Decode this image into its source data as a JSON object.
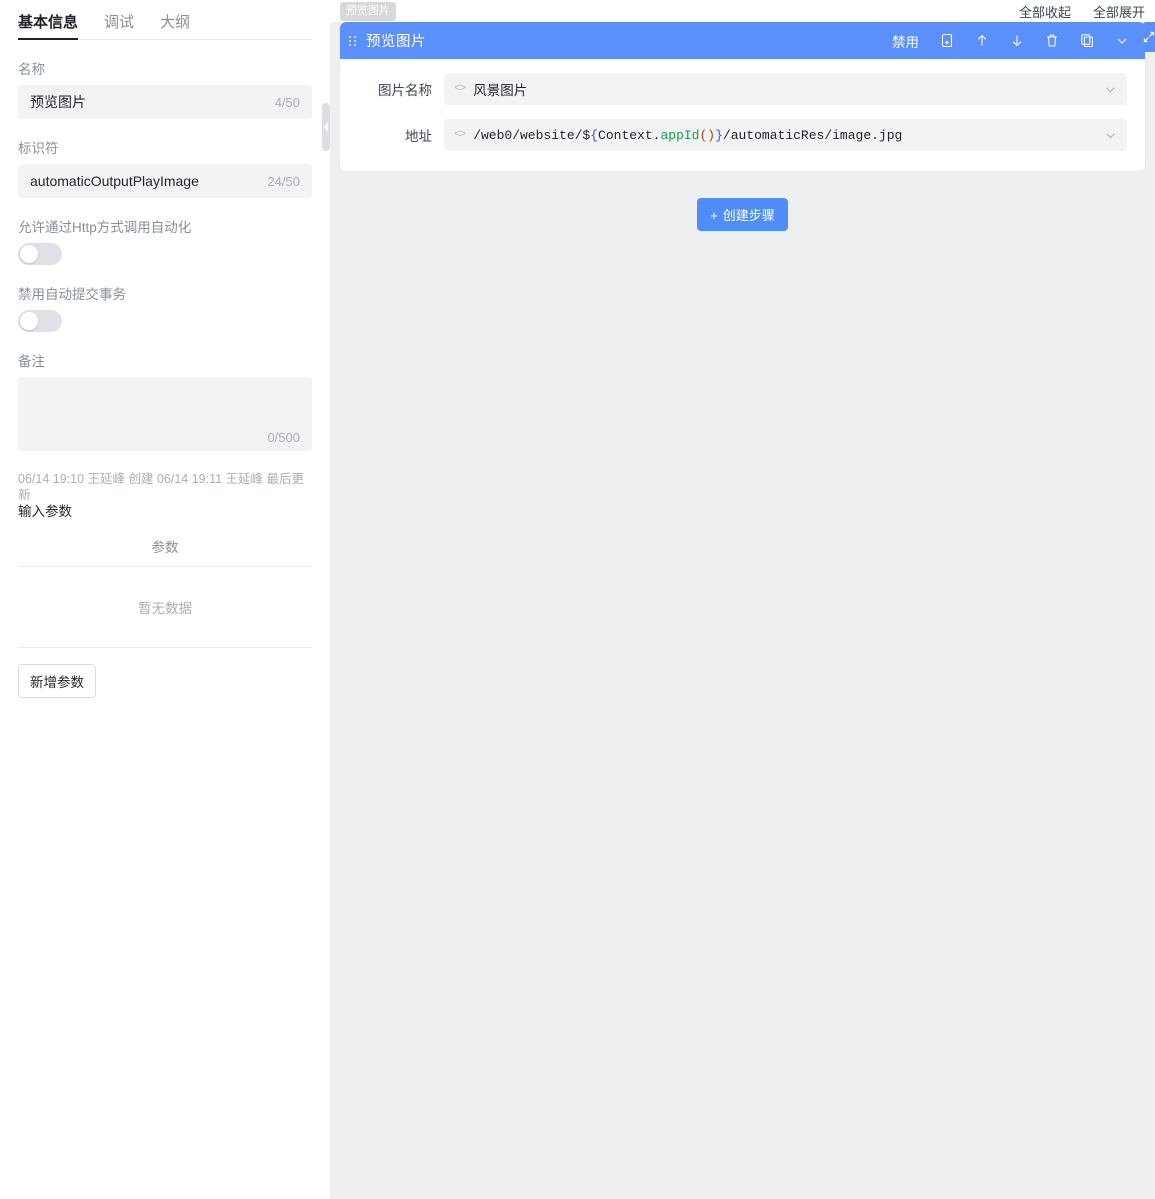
{
  "left_panel": {
    "tabs": [
      {
        "label": "基本信息",
        "active": true
      },
      {
        "label": "调试",
        "active": false
      },
      {
        "label": "大纲",
        "active": false
      }
    ],
    "fields": {
      "name_label": "名称",
      "name_value": "预览图片",
      "name_counter": "4/50",
      "identifier_label": "标识符",
      "identifier_value": "automaticOutputPlayImage",
      "identifier_counter": "24/50",
      "http_toggle_label": "允许通过Http方式调用自动化",
      "http_toggle_state": "off",
      "autocommit_toggle_label": "禁用自动提交事务",
      "autocommit_toggle_state": "off",
      "remark_label": "备注",
      "remark_value": "",
      "remark_counter": "0/500"
    },
    "meta_text": "06/14 19:10 王延峰 创建 06/14 19:11 王延峰 最后更新",
    "input_params": {
      "section_title": "输入参数",
      "column_header": "参数",
      "empty_text": "暂无数据",
      "add_button_label": "新增参数"
    },
    "collapse_handle_icon": "chevron-left-icon"
  },
  "right_panel": {
    "breadcrumb_tag": "预览图片",
    "toolbar": {
      "collapse_all_label": "全部收起",
      "expand_all_label": "全部展开"
    },
    "step_card": {
      "title": "预览图片",
      "drag_handle_icon": "drag-dots-icon",
      "header_actions": {
        "disable_label": "禁用",
        "icons": [
          "document-copy-icon",
          "arrow-up-icon",
          "arrow-down-icon",
          "trash-icon",
          "duplicate-icon",
          "chevron-down-icon"
        ]
      },
      "rows": [
        {
          "label": "图片名称",
          "prefix_icon": "code-brackets-icon",
          "value": "风景图片",
          "mono": false,
          "suffix_icon": "chevron-down-icon"
        },
        {
          "label": "地址",
          "prefix_icon": "code-brackets-icon",
          "value": "/web0/website/${Context.appId()}/automaticRes/image.jpg",
          "mono": true,
          "suffix_icon": "chevron-down-icon",
          "tokens": [
            {
              "t": "/web0/website/$",
              "c": "plain"
            },
            {
              "t": "{",
              "c": "brace"
            },
            {
              "t": "Context.",
              "c": "plain"
            },
            {
              "t": "appId",
              "c": "fn"
            },
            {
              "t": "()",
              "c": "paren"
            },
            {
              "t": "}",
              "c": "brace"
            },
            {
              "t": "/automaticRes/image.jpg",
              "c": "plain"
            }
          ]
        }
      ]
    },
    "create_step_button": {
      "plus": "+",
      "label": "创建步骤"
    },
    "edge_float_icon": "expand-panel-icon"
  },
  "colors": {
    "accent_blue": "#5b8ff9",
    "button_blue": "#4f8dfb",
    "panel_bg": "#eeeff1",
    "input_bg": "#f2f3f5",
    "text_primary": "#1f2329",
    "text_secondary": "#86909c",
    "token_brace": "#2f54eb",
    "token_fn": "#1a9c46",
    "token_paren": "#d4380d"
  }
}
